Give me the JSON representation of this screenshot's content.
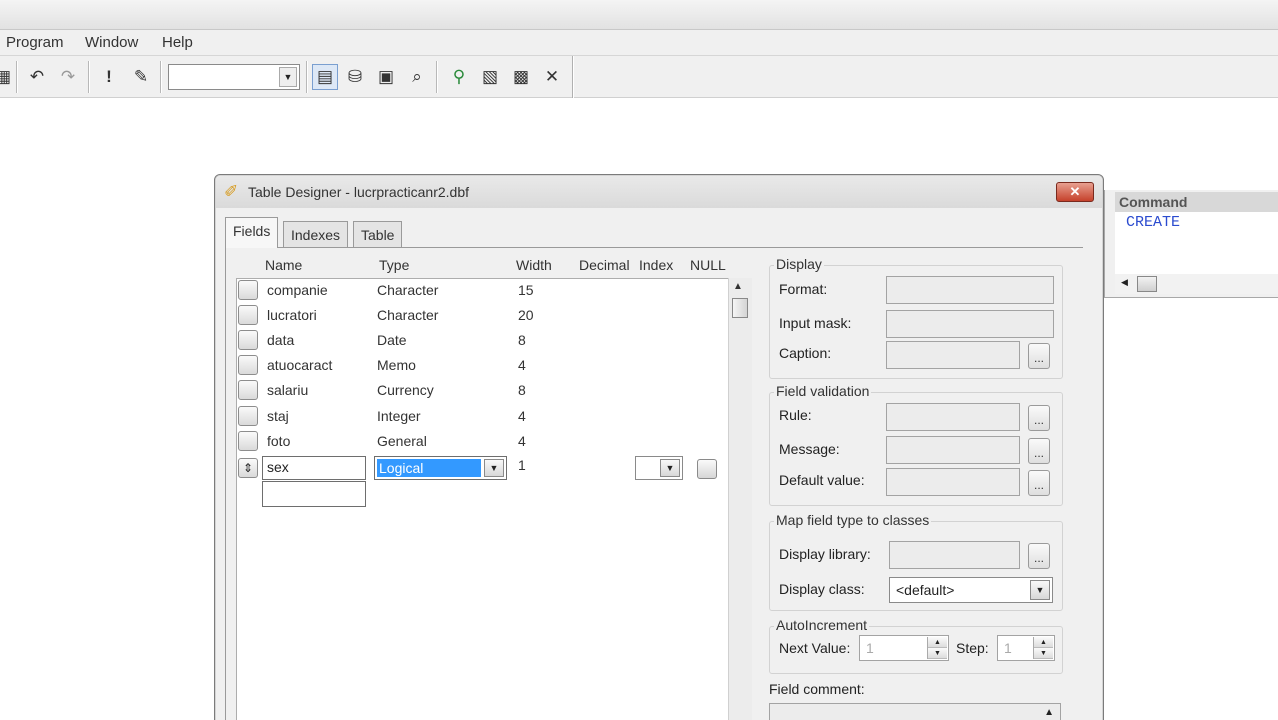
{
  "menubar": {
    "items": [
      "Program",
      "Window",
      "Help"
    ]
  },
  "toolbar": {
    "combo_value": "",
    "icons": [
      "print-icon",
      "undo-icon",
      "redo-icon",
      "run-icon",
      "modify-icon",
      "command-window-icon",
      "data-session-icon",
      "properties-icon",
      "code-view-icon",
      "class-browser-icon",
      "object-browser-icon",
      "task-list-icon",
      "toolbox-icon"
    ]
  },
  "dialog": {
    "title": "Table Designer - lucrpracticanr2.dbf",
    "close_label": "✕",
    "tabs": [
      "Fields",
      "Indexes",
      "Table"
    ],
    "active_tab": "Fields",
    "columns": {
      "name": "Name",
      "type": "Type",
      "width": "Width",
      "decimal": "Decimal",
      "index": "Index",
      "null": "NULL"
    },
    "rows": [
      {
        "name": "companie",
        "type": "Character",
        "width": "15"
      },
      {
        "name": "lucratori",
        "type": "Character",
        "width": "20"
      },
      {
        "name": "data",
        "type": "Date",
        "width": "8"
      },
      {
        "name": "atuocaract",
        "type": "Memo",
        "width": "4"
      },
      {
        "name": "salariu",
        "type": "Currency",
        "width": "8"
      },
      {
        "name": "staj",
        "type": "Integer",
        "width": "4"
      },
      {
        "name": "foto",
        "type": "General",
        "width": "4"
      }
    ],
    "editing_row": {
      "name": "sex",
      "type": "Logical",
      "width": "1",
      "index": ""
    },
    "new_row_name": "",
    "display": {
      "title": "Display",
      "format_label": "Format:",
      "input_mask_label": "Input mask:",
      "caption_label": "Caption:"
    },
    "validation": {
      "title": "Field validation",
      "rule_label": "Rule:",
      "message_label": "Message:",
      "default_label": "Default value:"
    },
    "map": {
      "title": "Map field type to classes",
      "library_label": "Display library:",
      "class_label": "Display class:",
      "class_value": "<default>"
    },
    "autoinc": {
      "title": "AutoIncrement",
      "next_label": "Next Value:",
      "next_value": "1",
      "step_label": "Step:",
      "step_value": "1"
    },
    "comment_label": "Field comment:",
    "ellipsis": "..."
  },
  "command_window": {
    "title": "Command",
    "text": "CREATE"
  }
}
